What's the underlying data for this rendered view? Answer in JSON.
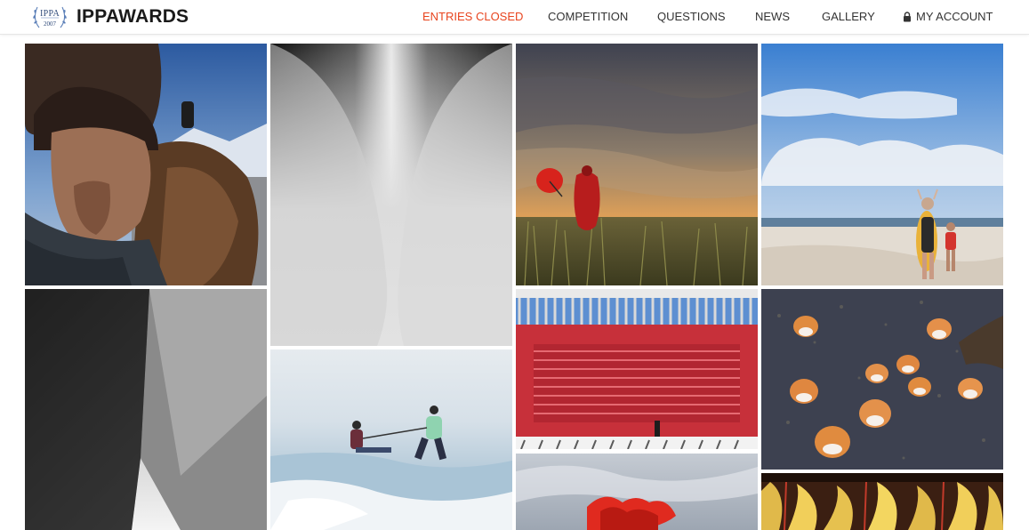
{
  "header": {
    "logo": {
      "seal_top": "IPPA",
      "seal_bottom": "2007",
      "brand": "IPPAWARDS"
    },
    "nav": [
      {
        "label": "ENTRIES CLOSED",
        "active": true
      },
      {
        "label": "COMPETITION",
        "active": false
      },
      {
        "label": "QUESTIONS",
        "active": false
      },
      {
        "label": "NEWS",
        "active": false
      },
      {
        "label": "GALLERY",
        "active": false
      },
      {
        "label": "MY ACCOUNT",
        "active": false,
        "icon": "lock-icon"
      }
    ],
    "accent_color": "#e8441e"
  },
  "gallery": {
    "photos": [
      {
        "subject": "eagle-hunter-portrait"
      },
      {
        "subject": "abstract-gray-curves"
      },
      {
        "subject": "red-umbrella-dunes-sunset"
      },
      {
        "subject": "beach-costume-figure"
      },
      {
        "subject": "black-white-architecture"
      },
      {
        "subject": "ice-skaters-frozen-lake"
      },
      {
        "subject": "red-wall-pergola"
      },
      {
        "subject": "foxes-on-asphalt"
      },
      {
        "subject": "red-flower-cloudy-sky"
      },
      {
        "subject": "yellow-fabric-drapes"
      }
    ]
  }
}
